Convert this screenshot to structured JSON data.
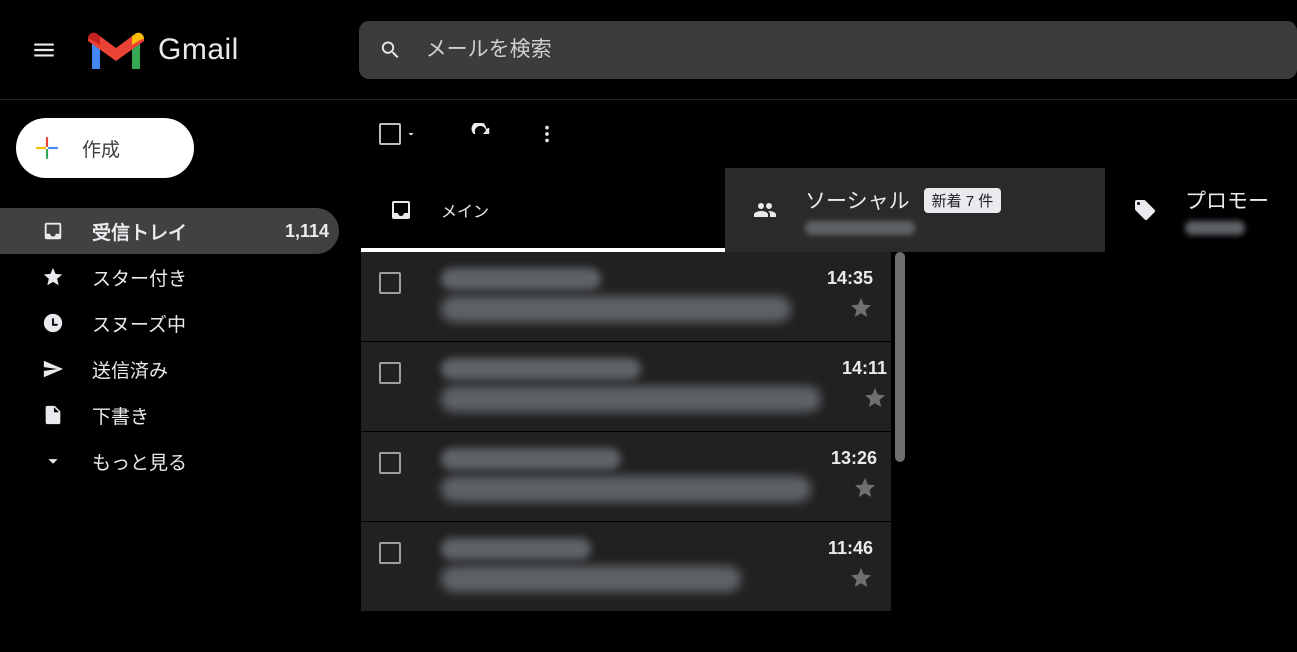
{
  "header": {
    "app_name": "Gmail",
    "search_placeholder": "メールを検索"
  },
  "compose": {
    "label": "作成"
  },
  "sidebar": {
    "items": [
      {
        "id": "inbox",
        "label": "受信トレイ",
        "count": "1,114",
        "active": true
      },
      {
        "id": "starred",
        "label": "スター付き"
      },
      {
        "id": "snoozed",
        "label": "スヌーズ中"
      },
      {
        "id": "sent",
        "label": "送信済み"
      },
      {
        "id": "drafts",
        "label": "下書き"
      },
      {
        "id": "more",
        "label": "もっと見る"
      }
    ]
  },
  "tabs": {
    "main": {
      "label": "メイン"
    },
    "social": {
      "label": "ソーシャル",
      "badge": "新着 7 件"
    },
    "promo": {
      "label": "プロモー"
    }
  },
  "threads": [
    {
      "time": "14:35",
      "sender_w": 160,
      "subject_w": 350
    },
    {
      "time": "14:11",
      "sender_w": 200,
      "subject_w": 380
    },
    {
      "time": "13:26",
      "sender_w": 180,
      "subject_w": 370
    },
    {
      "time": "11:46",
      "sender_w": 150,
      "subject_w": 300
    }
  ]
}
